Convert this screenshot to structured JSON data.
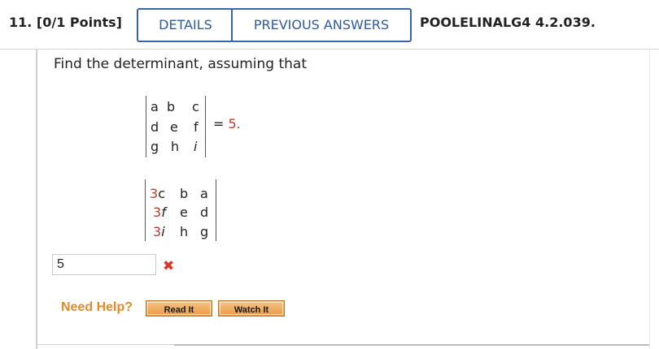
{
  "header": {
    "question_number": "11. [0/1 Points]",
    "details_label": "DETAILS",
    "previous_answers_label": "PREVIOUS ANSWERS",
    "question_ref": "POOLELINALG4 4.2.039."
  },
  "question": {
    "prompt": "Find the determinant, assuming that",
    "given_matrix": [
      [
        "a",
        "b",
        "c"
      ],
      [
        "d",
        "e",
        "f"
      ],
      [
        "g",
        "h",
        "i"
      ]
    ],
    "equals_text": "=",
    "given_value": "5.",
    "target_matrix": [
      {
        "coef": "3",
        "vars": [
          "c",
          "b",
          "a"
        ]
      },
      {
        "coef": "3",
        "vars": [
          "f",
          "e",
          "d"
        ]
      },
      {
        "coef": "3",
        "vars": [
          "i",
          "h",
          "g"
        ]
      }
    ]
  },
  "answer": {
    "value": "5",
    "status": "incorrect",
    "status_icon": "x-icon",
    "status_color": "#d9352b"
  },
  "help": {
    "label": "Need Help?",
    "read_label": "Read It",
    "watch_label": "Watch It",
    "label_color": "#e08a2a",
    "button_color": "#e99a45"
  },
  "colors": {
    "accent": "#3a64a8",
    "highlight": "#c0392b"
  }
}
